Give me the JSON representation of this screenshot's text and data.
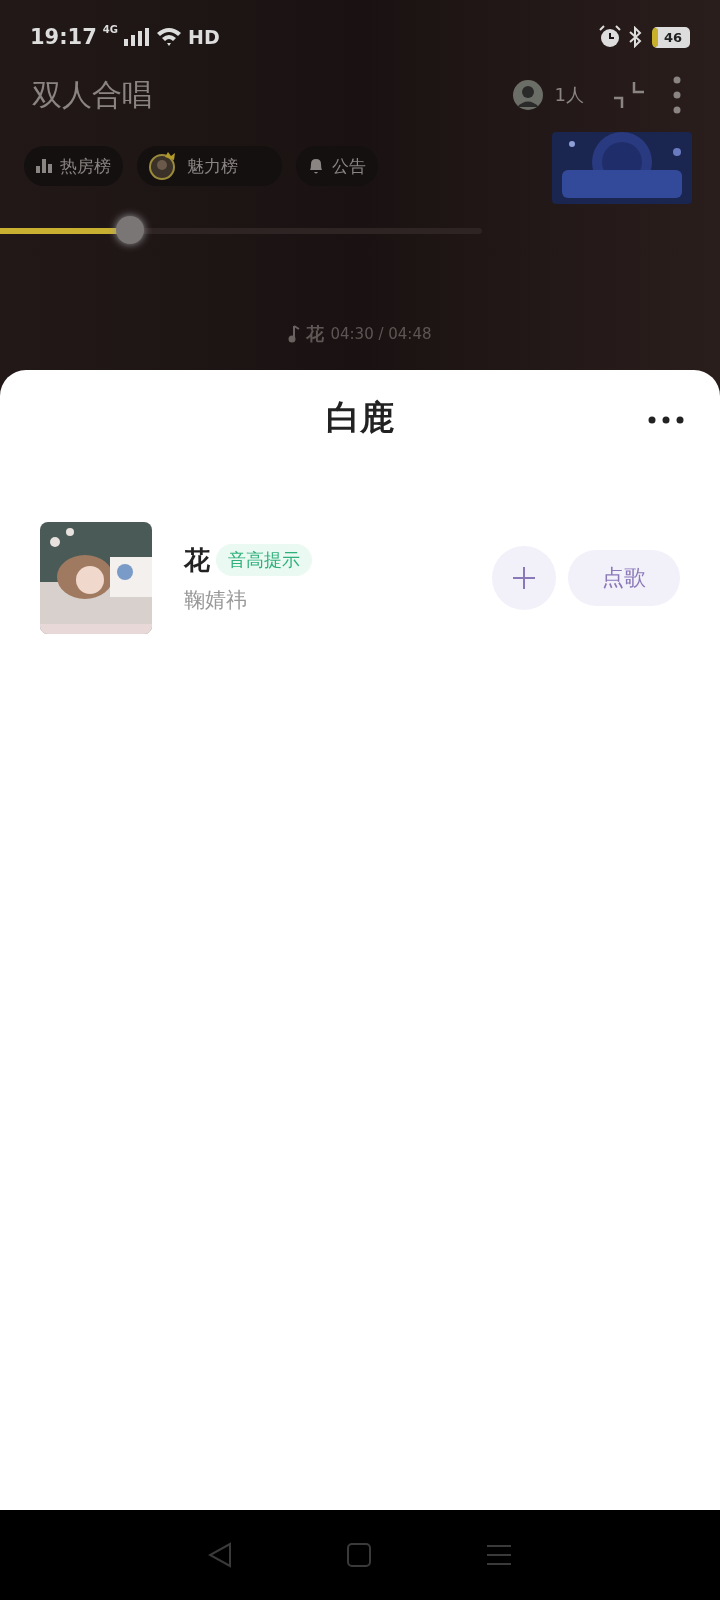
{
  "status_bar": {
    "time": "19:17",
    "network": "4G",
    "wifi_label": "HD",
    "battery": "46"
  },
  "room": {
    "title": "双人合唱",
    "audience": "1人"
  },
  "chips": [
    {
      "kind": "hot",
      "label": "热房榜"
    },
    {
      "kind": "charm",
      "label": "魅力榜"
    },
    {
      "kind": "notice",
      "label": "公告"
    }
  ],
  "progress": {
    "level": 0.27
  },
  "now_playing": {
    "song": "花",
    "time": "04:30 / 04:48"
  },
  "sheet": {
    "title": "白鹿",
    "songs": [
      {
        "title": "花",
        "tag": "音高提示",
        "artist": "鞠婧祎",
        "action": "点歌"
      }
    ]
  }
}
